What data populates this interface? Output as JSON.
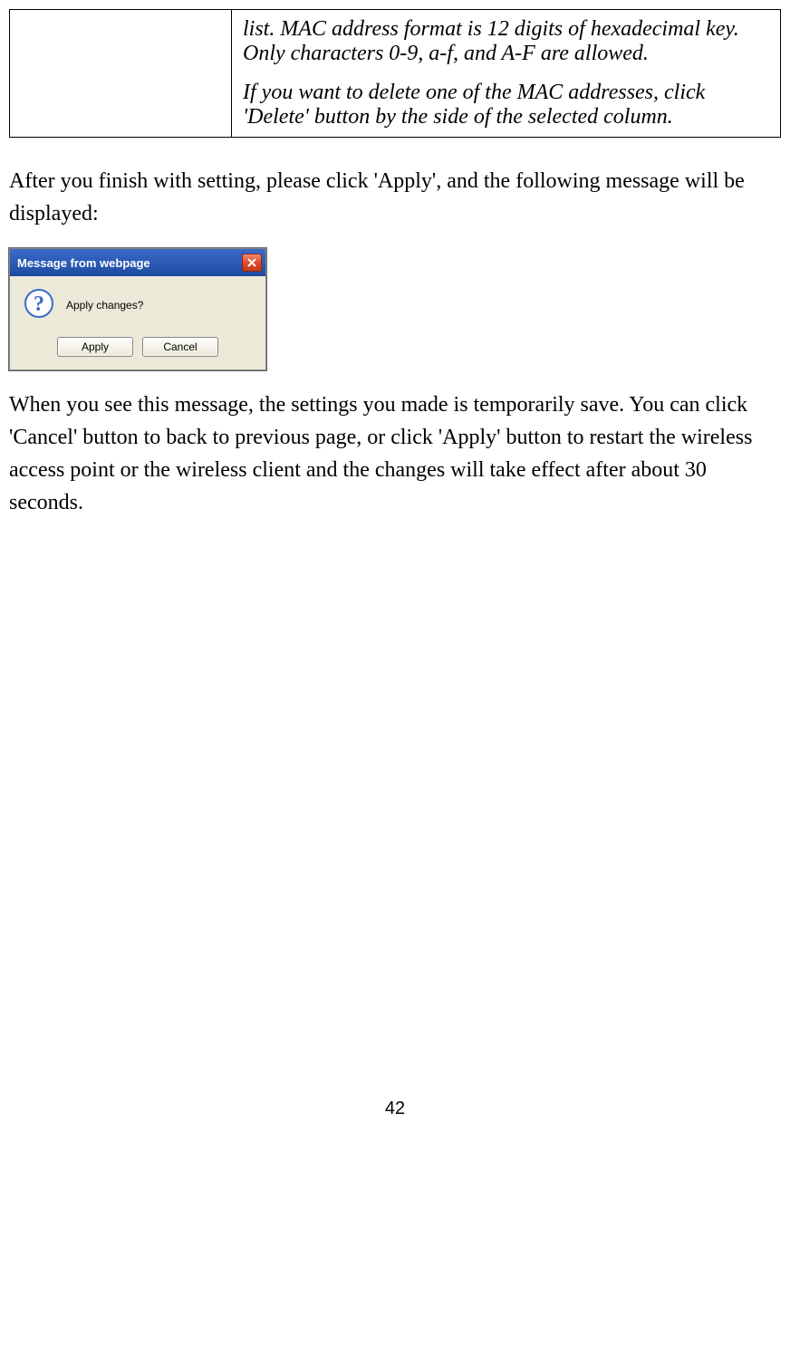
{
  "tableCell": {
    "line1": "list. MAC address format is 12 digits of hexadecimal key. Only characters 0-9, a-f, and A-F are allowed.",
    "line2": "If you want to delete one of the MAC addresses, click 'Delete' button by the side of the selected column."
  },
  "paragraph1": "After you finish with setting, please click 'Apply', and the following message will be displayed:",
  "dialog": {
    "title": "Message from webpage",
    "message": "Apply changes?",
    "applyLabel": "Apply",
    "cancelLabel": "Cancel"
  },
  "paragraph2": "When you see this message, the settings you made is temporarily save. You can click 'Cancel' button to back to previous page, or click 'Apply' button to restart the wireless access point or the wireless client and the changes will take effect after about 30 seconds.",
  "pageNumber": "42"
}
